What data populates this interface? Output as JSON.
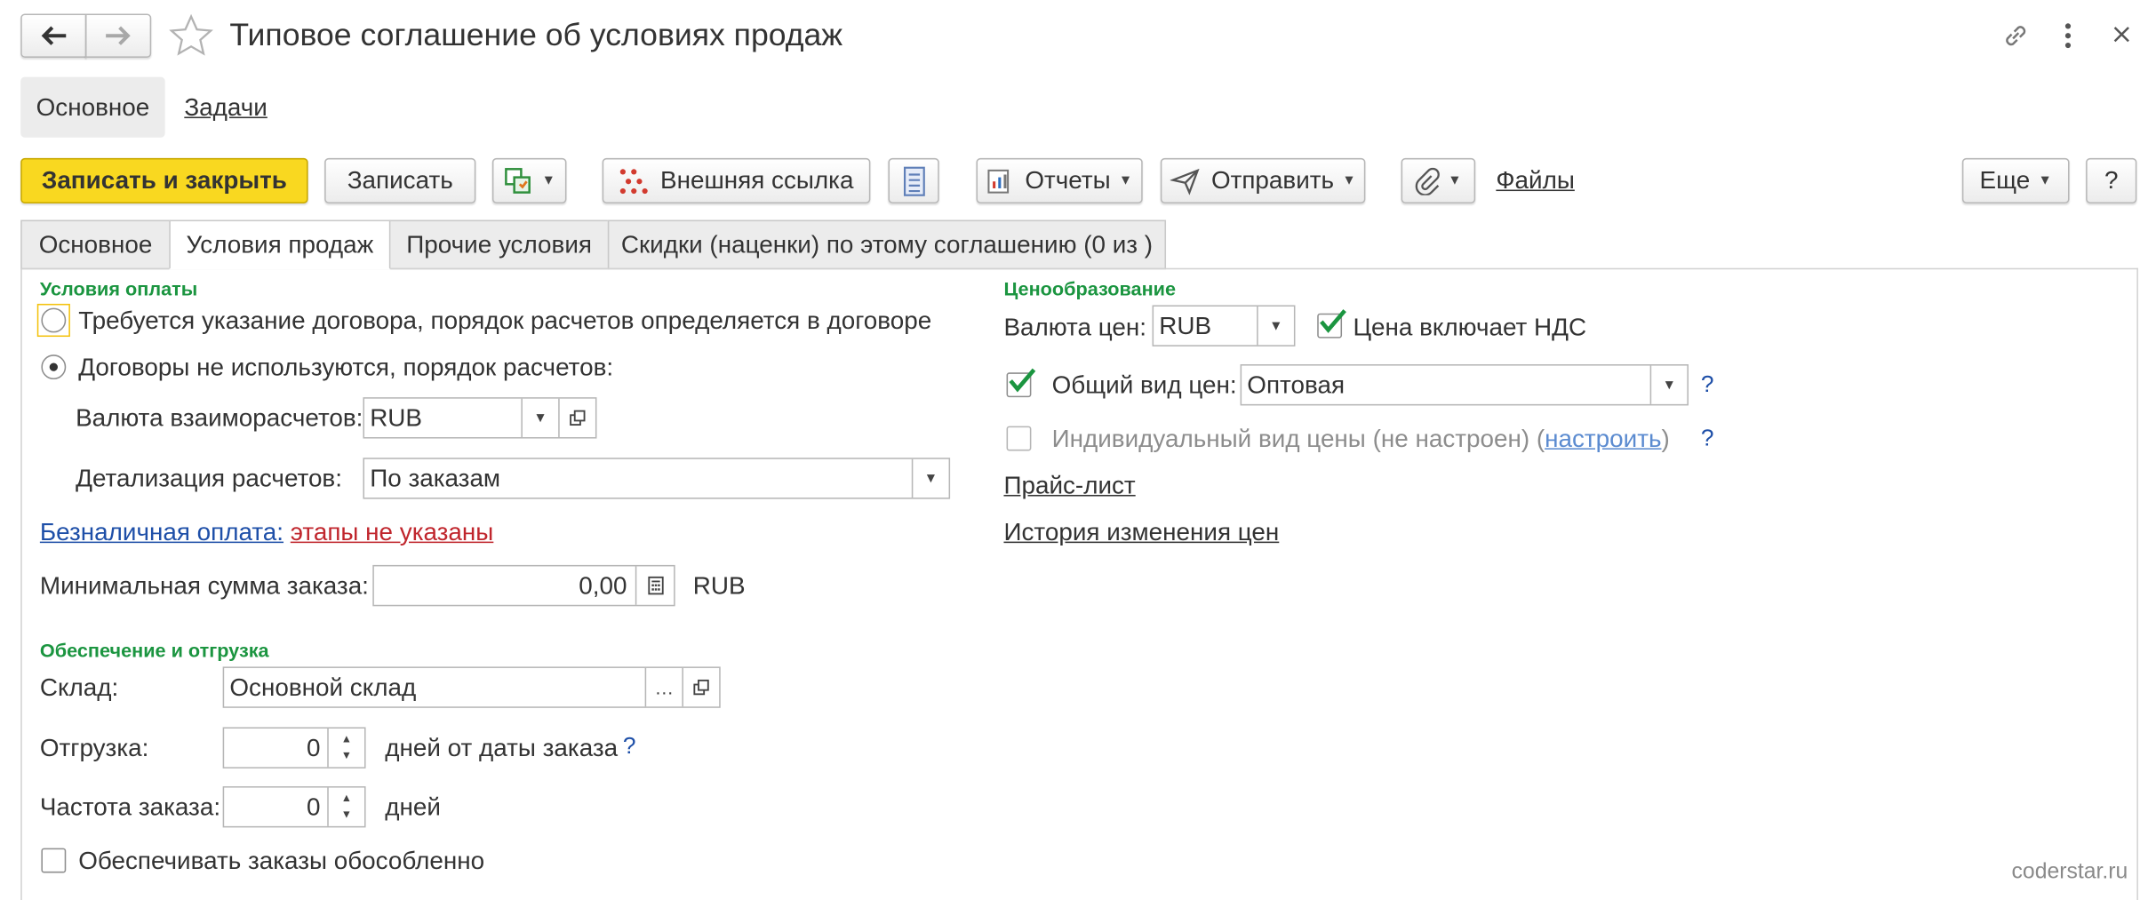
{
  "window": {
    "title": "Типовое соглашение об условиях продаж"
  },
  "section_tabs": {
    "main": "Основное",
    "tasks": "Задачи"
  },
  "toolbar": {
    "save_close": "Записать и закрыть",
    "save": "Записать",
    "external_link": "Внешняя ссылка",
    "reports": "Отчеты",
    "send": "Отправить",
    "files": "Файлы",
    "more": "Еще",
    "help": "?"
  },
  "tabs": {
    "main": "Основное",
    "sales_terms": "Условия продаж",
    "other_terms": "Прочие условия",
    "discounts": "Скидки (наценки) по этому соглашению (0 из )"
  },
  "payment": {
    "group_title": "Условия оплаты",
    "radio1": "Требуется указание договора, порядок расчетов определяется в договоре",
    "radio2": "Договоры не используются, порядок расчетов:",
    "currency_label": "Валюта взаиморасчетов:",
    "currency_value": "RUB",
    "detail_label": "Детализация расчетов:",
    "detail_value": "По заказам",
    "cashless_link": "Безналичная оплата:",
    "cashless_status": "этапы не указаны",
    "min_sum_label": "Минимальная сумма заказа:",
    "min_sum_value": "0,00",
    "min_sum_currency": "RUB"
  },
  "supply": {
    "group_title": "Обеспечение и отгрузка",
    "warehouse_label": "Склад:",
    "warehouse_value": "Основной склад",
    "shipment_label": "Отгрузка:",
    "shipment_value": "0",
    "shipment_suffix": "дней от даты заказа",
    "frequency_label": "Частота заказа:",
    "frequency_value": "0",
    "frequency_suffix": "дней",
    "separate_label": "Обеспечивать заказы обособленно"
  },
  "pricing": {
    "group_title": "Ценообразование",
    "currency_label": "Валюта цен:",
    "currency_value": "RUB",
    "vat_label": "Цена включает НДС",
    "general_label": "Общий вид цен:",
    "general_value": "Оптовая",
    "individual_label_prefix": "Индивидуальный вид цены (не настроен) (",
    "individual_link": "настроить",
    "individual_label_suffix": ")",
    "price_list_link": "Прайс-лист",
    "history_link": "История изменения цен"
  },
  "watermark": "coderstar.ru",
  "colors": {
    "primary_button": "#f9d820",
    "group_title": "#1b9540",
    "link": "#1e4fa8",
    "error": "#c0262d"
  }
}
